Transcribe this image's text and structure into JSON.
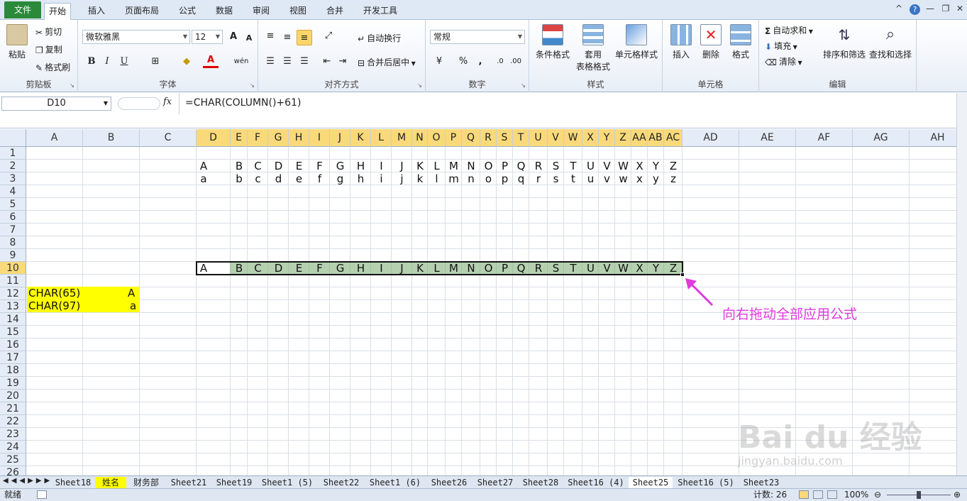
{
  "tabs": [
    "文件",
    "开始",
    "插入",
    "页面布局",
    "公式",
    "数据",
    "审阅",
    "视图",
    "合并",
    "开发工具"
  ],
  "active_tab": "开始",
  "window_controls": {
    "help": "?",
    "minimize": "—",
    "restore": "❐",
    "close": "✕",
    "ribbon_toggle": "^"
  },
  "clipboard": {
    "paste": "粘贴",
    "cut": "剪切",
    "copy": "复制",
    "format_painter": "格式刷",
    "label": "剪贴板"
  },
  "font": {
    "name": "微软雅黑",
    "size": "12",
    "grow": "A",
    "shrink": "A",
    "bold": "B",
    "italic": "I",
    "underline": "U",
    "wen": "wén",
    "label": "字体"
  },
  "alignment": {
    "wrap": "自动换行",
    "merge": "合并后居中",
    "label": "对齐方式"
  },
  "number": {
    "format": "常规",
    "percent": "%",
    "comma": ",",
    "label": "数字"
  },
  "styles": {
    "conditional": "条件格式",
    "table_format_1": "套用",
    "table_format_2": "表格格式",
    "cell_styles": "单元格样式",
    "label": "样式"
  },
  "cells": {
    "insert": "插入",
    "delete": "删除",
    "format": "格式",
    "label": "单元格"
  },
  "editing": {
    "autosum": "自动求和",
    "fill": "填充",
    "clear": "清除",
    "sort": "排序和筛选",
    "find": "查找和选择",
    "label": "编辑"
  },
  "formula_bar": {
    "name_box": "D10",
    "fx": "fx",
    "formula": "=CHAR(COLUMN()+61)"
  },
  "columns": [
    "A",
    "B",
    "C",
    "D",
    "E",
    "F",
    "G",
    "H",
    "I",
    "J",
    "K",
    "L",
    "M",
    "N",
    "O",
    "P",
    "Q",
    "R",
    "S",
    "T",
    "U",
    "V",
    "W",
    "X",
    "Y",
    "Z",
    "AA",
    "AB",
    "AC",
    "AD",
    "AE",
    "AF",
    "AG",
    "AH"
  ],
  "rows": [
    "1",
    "2",
    "3",
    "4",
    "5",
    "6",
    "7",
    "8",
    "9",
    "10",
    "11",
    "12",
    "13",
    "14",
    "15",
    "16",
    "17",
    "18",
    "19",
    "20",
    "21",
    "22",
    "23",
    "24",
    "25",
    "26"
  ],
  "row2": [
    "A",
    "B",
    "C",
    "D",
    "E",
    "F",
    "G",
    "H",
    "I",
    "J",
    "K",
    "L",
    "M",
    "N",
    "O",
    "P",
    "Q",
    "R",
    "S",
    "T",
    "U",
    "V",
    "W",
    "X",
    "Y",
    "Z"
  ],
  "row3": [
    "a",
    "b",
    "c",
    "d",
    "e",
    "f",
    "g",
    "h",
    "i",
    "j",
    "k",
    "l",
    "m",
    "n",
    "o",
    "p",
    "q",
    "r",
    "s",
    "t",
    "u",
    "v",
    "w",
    "x",
    "y",
    "z"
  ],
  "row10": [
    "A",
    "B",
    "C",
    "D",
    "E",
    "F",
    "G",
    "H",
    "I",
    "J",
    "K",
    "L",
    "M",
    "N",
    "O",
    "P",
    "Q",
    "R",
    "S",
    "T",
    "U",
    "V",
    "W",
    "X",
    "Y",
    "Z"
  ],
  "cells_left": {
    "a12": "CHAR(65)",
    "b12": "A",
    "a13": "CHAR(97)",
    "b13": "a"
  },
  "annotation": "向右拖动全部应用公式",
  "watermark": "Bai du 经验",
  "watermark_url": "jingyan.baidu.com",
  "sheets": [
    "Sheet18",
    "姓名",
    "财务部",
    "Sheet21",
    "Sheet19",
    "Sheet1 (5)",
    "Sheet22",
    "Sheet1 (6)",
    "Sheet26",
    "Sheet27",
    "Sheet28",
    "Sheet16 (4)",
    "Sheet25",
    "Sheet16 (5)",
    "Sheet23"
  ],
  "active_sheet": "Sheet25",
  "status": {
    "ready": "就绪",
    "count": "计数: 26",
    "zoom": "100%"
  },
  "colors": {
    "selection_fill": "#8fbf85",
    "annotation": "#e03adf",
    "header_selected": "#f9d97a",
    "highlight": "#ffff00"
  }
}
